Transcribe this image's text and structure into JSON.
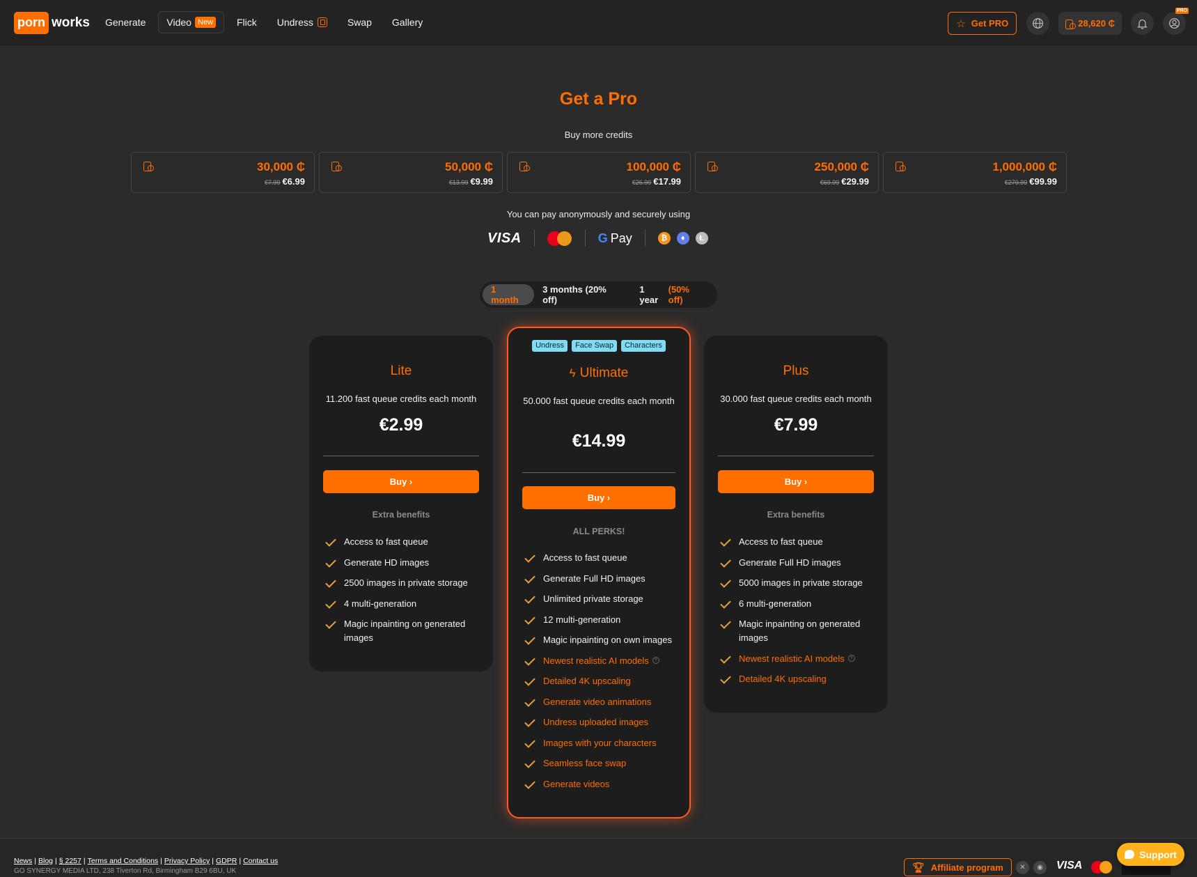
{
  "brand": {
    "logo_left": "porn",
    "logo_right": "works"
  },
  "nav": {
    "generate": "Generate",
    "video": "Video",
    "video_badge": "New",
    "flick": "Flick",
    "undress": "Undress",
    "swap": "Swap",
    "gallery": "Gallery"
  },
  "header": {
    "get_pro": "Get PRO",
    "credits": "28,620 ₵",
    "pro_tag": "PRO"
  },
  "page": {
    "title": "Get a Pro",
    "buy_more": "Buy more credits",
    "anon_text": "You can pay anonymously and securely using"
  },
  "credit_packs": [
    {
      "amount": "30,000 ₵",
      "old_price": "€7.99",
      "price": "€6.99"
    },
    {
      "amount": "50,000 ₵",
      "old_price": "€13.99",
      "price": "€9.99"
    },
    {
      "amount": "100,000 ₵",
      "old_price": "€26.99",
      "price": "€17.99"
    },
    {
      "amount": "250,000 ₵",
      "old_price": "€69.99",
      "price": "€29.99"
    },
    {
      "amount": "1,000,000 ₵",
      "old_price": "€279.99",
      "price": "€99.99"
    }
  ],
  "payment_methods": {
    "visa": "VISA",
    "gpay_g": "G",
    "gpay": "Pay",
    "btc": "₿",
    "eth": "♦",
    "ltc": "Ł"
  },
  "period": {
    "one_month": "1 month",
    "three_months": "3 months (20% off)",
    "one_year": "1 year",
    "one_year_discount": "(50% off)",
    "selected": "1 month"
  },
  "plans": {
    "lite": {
      "name": "Lite",
      "description": "11.200 fast queue credits each month",
      "price": "€2.99",
      "buy": "Buy ›",
      "extra_label": "Extra benefits",
      "features": [
        "Access to fast queue",
        "Generate HD images",
        "2500 images in private storage",
        "4 multi-generation",
        "Magic inpainting on generated images"
      ]
    },
    "ultimate": {
      "tags": [
        "Undress",
        "Face Swap",
        "Characters"
      ],
      "name": "Ultimate",
      "description": "50.000 fast queue credits each month",
      "price": "€14.99",
      "buy": "Buy ›",
      "extra_label": "ALL PERKS!",
      "features": [
        "Access to fast queue",
        "Generate Full HD images",
        "Unlimited private storage",
        "12 multi-generation",
        "Magic inpainting on own images"
      ],
      "highlight_features": [
        "Newest realistic AI models",
        "Detailed 4K upscaling",
        "Generate video animations",
        "Undress uploaded images",
        "Images with your characters",
        "Seamless face swap",
        "Generate videos"
      ]
    },
    "plus": {
      "name": "Plus",
      "description": "30.000 fast queue credits each month",
      "price": "€7.99",
      "buy": "Buy ›",
      "extra_label": "Extra benefits",
      "features": [
        "Access to fast queue",
        "Generate Full HD images",
        "5000 images in private storage",
        "6 multi-generation",
        "Magic inpainting on generated images"
      ],
      "highlight_features": [
        "Newest realistic AI models",
        "Detailed 4K upscaling"
      ]
    }
  },
  "footer": {
    "links": [
      "News",
      "Blog",
      "§ 2257",
      "Terms and Conditions",
      "Privacy Policy",
      "GDPR",
      "Contact us"
    ],
    "company": "GO SYNERGY MEDIA LTD, 238 Tiverton Rd, Birmingham B29 6BU, UK",
    "affiliate": "Affiliate program",
    "visa": "VISA",
    "support": "Support"
  },
  "colors": {
    "accent": "#ff6f00",
    "tag": "#7fdcf2",
    "background": "#2b2b2b"
  }
}
